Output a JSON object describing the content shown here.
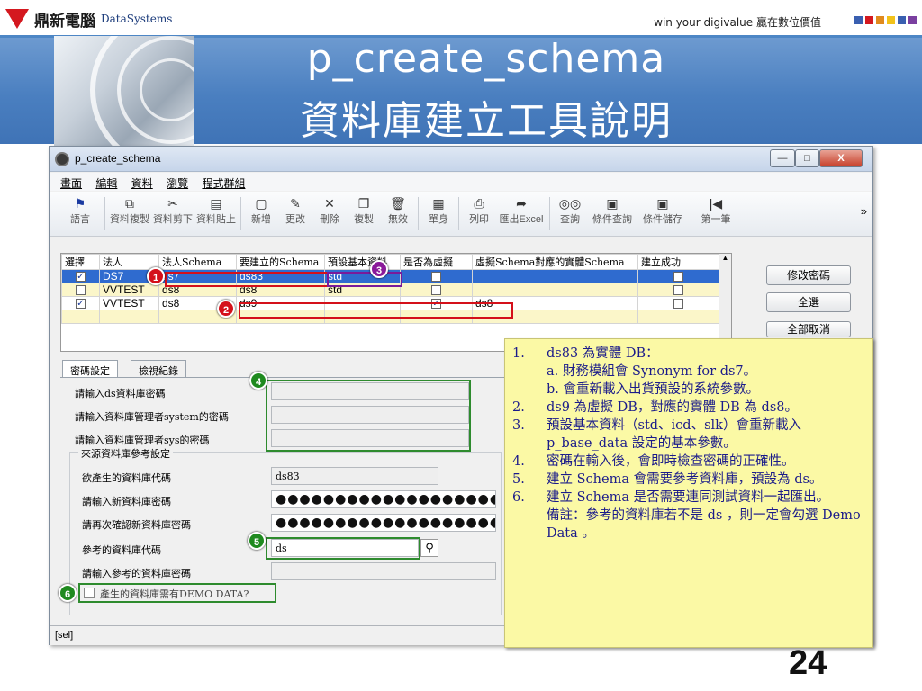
{
  "slide": {
    "logo_cn": "鼎新電腦",
    "logo_en": "DataSystems",
    "tagline": "win your digivalue 贏在數位價值",
    "title_line1": "p_create_schema",
    "title_line2": "資料庫建立工具說明",
    "page_number": "24",
    "tagline_colors": [
      "#3a5fb0",
      "#d4181f",
      "#e08a1e",
      "#f2c21a",
      "#3a5fb0",
      "#7a3fa0"
    ]
  },
  "window": {
    "title": "p_create_schema",
    "menu": [
      "畫面",
      "編輯",
      "資料",
      "瀏覽",
      "程式群組"
    ],
    "toolbar": [
      {
        "label": "語言",
        "icon": "flag-icon"
      },
      {
        "label": "資料複製",
        "icon": "copy-icon"
      },
      {
        "label": "資料剪下",
        "icon": "cut-icon"
      },
      {
        "label": "資料貼上",
        "icon": "paste-icon"
      },
      {
        "label": "新增",
        "icon": "new-icon"
      },
      {
        "label": "更改",
        "icon": "edit-icon"
      },
      {
        "label": "刪除",
        "icon": "delete-icon"
      },
      {
        "label": "複製",
        "icon": "duplicate-icon"
      },
      {
        "label": "無效",
        "icon": "invalid-icon"
      },
      {
        "label": "單身",
        "icon": "detail-icon"
      },
      {
        "label": "列印",
        "icon": "print-icon"
      },
      {
        "label": "匯出Excel",
        "icon": "export-icon"
      },
      {
        "label": "查詢",
        "icon": "binoculars-icon"
      },
      {
        "label": "條件查詢",
        "icon": "filter-query-icon"
      },
      {
        "label": "條件儲存",
        "icon": "filter-save-icon"
      },
      {
        "label": "第一筆",
        "icon": "first-record-icon"
      }
    ],
    "toolbar_more": "»",
    "grid": {
      "headers": [
        "選擇",
        "法人",
        "法人Schema",
        "要建立的Schema",
        "預設基本資料",
        "是否為虛擬",
        "虛擬Schema對應的實體Schema",
        "建立成功"
      ],
      "rows": [
        {
          "checked": true,
          "entity": "DS7",
          "entity_schema": "ds7",
          "new_schema": "ds83",
          "base_data": "std",
          "virtual": false,
          "real_schema": "",
          "success": false
        },
        {
          "checked": false,
          "entity": "VVTEST",
          "entity_schema": "ds8",
          "new_schema": "ds8",
          "base_data": "std",
          "virtual": false,
          "real_schema": "",
          "success": false
        },
        {
          "checked": true,
          "entity": "VVTEST",
          "entity_schema": "ds8",
          "new_schema": "ds9",
          "base_data": "",
          "virtual": true,
          "real_schema": "ds8",
          "success": false
        }
      ]
    },
    "side_buttons": {
      "change_password": "修改密碼",
      "select_all": "全選",
      "cancel_all": "全部取消"
    },
    "tabs": [
      "密碼設定",
      "檢視紀錄"
    ],
    "form": {
      "ds_password_label": "請輸入ds資料庫密碼",
      "system_password_label": "請輸入資料庫管理者system的密碼",
      "sys_password_label": "請輸入資料庫管理者sys的密碼",
      "group_title": "來源資料庫參考設定",
      "new_db_code_label": "欲產生的資料庫代碼",
      "new_db_code_value": "ds83",
      "new_db_password_label": "請輸入新資料庫密碼",
      "new_db_password_value": "●●●●●●●●●●●●●●●●●●●●",
      "confirm_password_label": "請再次確認新資料庫密碼",
      "confirm_password_value": "●●●●●●●●●●●●●●●●●●●●",
      "ref_db_code_label": "參考的資料庫代碼",
      "ref_db_code_value": "ds",
      "ref_db_password_label": "請輸入參考的資料庫密碼",
      "demo_data_label": "產生的資料庫需有DEMO DATA?"
    },
    "status": "[sel]"
  },
  "badges": [
    "1",
    "2",
    "3",
    "4",
    "5",
    "6"
  ],
  "notes": [
    {
      "num": "1.",
      "text": "ds83 為實體 DB："
    },
    {
      "num": "",
      "text": "a. 財務模組會 Synonym for ds7。",
      "sub": true
    },
    {
      "num": "",
      "text": "b. 會重新載入出貨預設的系統參數。",
      "sub": true
    },
    {
      "num": "2.",
      "text": "ds9 為虛擬 DB，對應的實體 DB 為 ds8。"
    },
    {
      "num": "3.",
      "text": "預設基本資料（std、icd、slk）會重新載入 p_base_data 設定的基本參數。"
    },
    {
      "num": "4.",
      "text": "密碼在輸入後，會即時檢查密碼的正確性。"
    },
    {
      "num": "5.",
      "text": "建立 Schema 會需要參考資料庫，預設為 ds。"
    },
    {
      "num": "6.",
      "text": "建立 Schema 是否需要連同測試資料一起匯出。"
    },
    {
      "num": "",
      "text": "備註：參考的資料庫若不是 ds ，則一定會勾選 Demo Data 。"
    }
  ]
}
